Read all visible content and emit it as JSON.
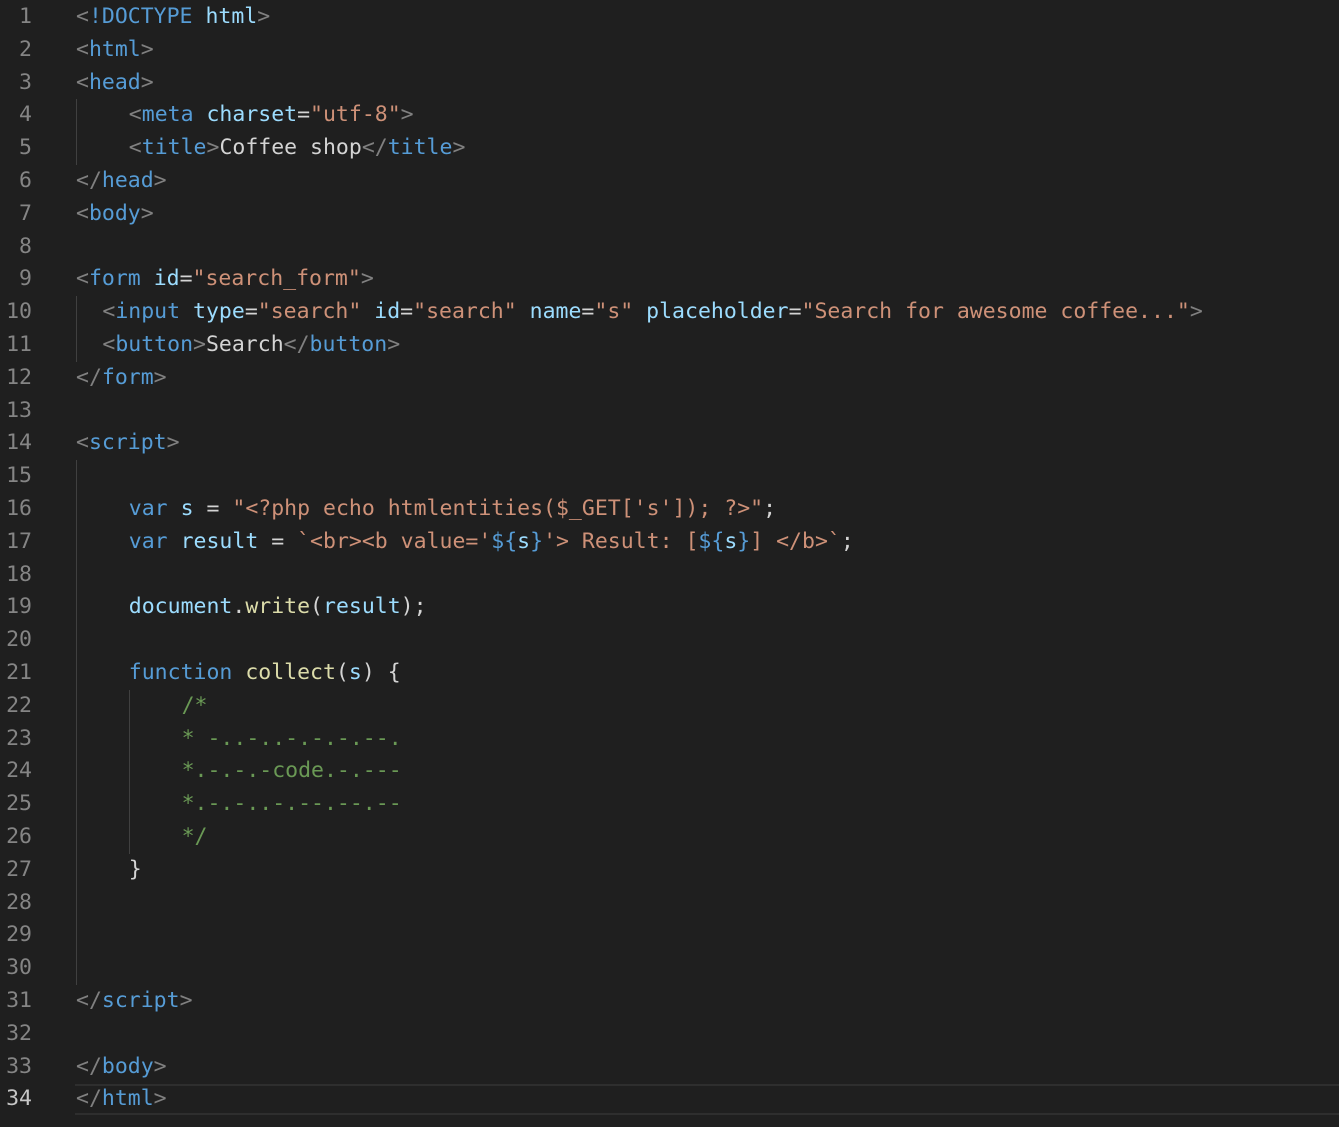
{
  "editor": {
    "current_line": 34,
    "lines": [
      {
        "n": "1",
        "indent": 0,
        "tokens": [
          [
            "punc",
            "<"
          ],
          [
            "tag",
            "!DOCTYPE"
          ],
          [
            "txt",
            " "
          ],
          [
            "attr",
            "html"
          ],
          [
            "punc",
            ">"
          ]
        ]
      },
      {
        "n": "2",
        "indent": 0,
        "tokens": [
          [
            "punc",
            "<"
          ],
          [
            "tag",
            "html"
          ],
          [
            "punc",
            ">"
          ]
        ]
      },
      {
        "n": "3",
        "indent": 0,
        "tokens": [
          [
            "punc",
            "<"
          ],
          [
            "tag",
            "head"
          ],
          [
            "punc",
            ">"
          ]
        ]
      },
      {
        "n": "4",
        "indent": 4,
        "tokens": [
          [
            "punc",
            "<"
          ],
          [
            "tag",
            "meta"
          ],
          [
            "txt",
            " "
          ],
          [
            "attr",
            "charset"
          ],
          [
            "txt",
            "="
          ],
          [
            "str",
            "\"utf-8\""
          ],
          [
            "punc",
            ">"
          ]
        ]
      },
      {
        "n": "5",
        "indent": 4,
        "tokens": [
          [
            "punc",
            "<"
          ],
          [
            "tag",
            "title"
          ],
          [
            "punc",
            ">"
          ],
          [
            "txt",
            "Coffee shop"
          ],
          [
            "punc",
            "</"
          ],
          [
            "tag",
            "title"
          ],
          [
            "punc",
            ">"
          ]
        ]
      },
      {
        "n": "6",
        "indent": 0,
        "tokens": [
          [
            "punc",
            "</"
          ],
          [
            "tag",
            "head"
          ],
          [
            "punc",
            ">"
          ]
        ]
      },
      {
        "n": "7",
        "indent": 0,
        "tokens": [
          [
            "punc",
            "<"
          ],
          [
            "tag",
            "body"
          ],
          [
            "punc",
            ">"
          ]
        ]
      },
      {
        "n": "8",
        "indent": 0,
        "tokens": []
      },
      {
        "n": "9",
        "indent": 0,
        "tokens": [
          [
            "punc",
            "<"
          ],
          [
            "tag",
            "form"
          ],
          [
            "txt",
            " "
          ],
          [
            "attr",
            "id"
          ],
          [
            "txt",
            "="
          ],
          [
            "str",
            "\"search_form\""
          ],
          [
            "punc",
            ">"
          ]
        ]
      },
      {
        "n": "10",
        "indent": 2,
        "tokens": [
          [
            "punc",
            "<"
          ],
          [
            "tag",
            "input"
          ],
          [
            "txt",
            " "
          ],
          [
            "attr",
            "type"
          ],
          [
            "txt",
            "="
          ],
          [
            "str",
            "\"search\""
          ],
          [
            "txt",
            " "
          ],
          [
            "attr",
            "id"
          ],
          [
            "txt",
            "="
          ],
          [
            "str",
            "\"search\""
          ],
          [
            "txt",
            " "
          ],
          [
            "attr",
            "name"
          ],
          [
            "txt",
            "="
          ],
          [
            "str",
            "\"s\""
          ],
          [
            "txt",
            " "
          ],
          [
            "attr",
            "placeholder"
          ],
          [
            "txt",
            "="
          ],
          [
            "str",
            "\"Search for awesome coffee...\""
          ],
          [
            "punc",
            ">"
          ]
        ]
      },
      {
        "n": "11",
        "indent": 2,
        "tokens": [
          [
            "punc",
            "<"
          ],
          [
            "tag",
            "button"
          ],
          [
            "punc",
            ">"
          ],
          [
            "txt",
            "Search"
          ],
          [
            "punc",
            "</"
          ],
          [
            "tag",
            "button"
          ],
          [
            "punc",
            ">"
          ]
        ]
      },
      {
        "n": "12",
        "indent": 0,
        "tokens": [
          [
            "punc",
            "</"
          ],
          [
            "tag",
            "form"
          ],
          [
            "punc",
            ">"
          ]
        ]
      },
      {
        "n": "13",
        "indent": 0,
        "tokens": []
      },
      {
        "n": "14",
        "indent": 0,
        "tokens": [
          [
            "punc",
            "<"
          ],
          [
            "tag",
            "script"
          ],
          [
            "punc",
            ">"
          ]
        ]
      },
      {
        "n": "15",
        "indent": 0,
        "tokens": []
      },
      {
        "n": "16",
        "indent": 4,
        "tokens": [
          [
            "kw",
            "var"
          ],
          [
            "txt",
            " "
          ],
          [
            "var",
            "s"
          ],
          [
            "txt",
            " = "
          ],
          [
            "str",
            "\"<?php echo htmlentities($_GET['s']); ?>\""
          ],
          [
            "txt",
            ";"
          ]
        ]
      },
      {
        "n": "17",
        "indent": 4,
        "tokens": [
          [
            "kw",
            "var"
          ],
          [
            "txt",
            " "
          ],
          [
            "var",
            "result"
          ],
          [
            "txt",
            " = "
          ],
          [
            "str",
            "`<br><b value='"
          ],
          [
            "kw",
            "${"
          ],
          [
            "var",
            "s"
          ],
          [
            "kw",
            "}"
          ],
          [
            "str",
            "'> Result: ["
          ],
          [
            "kw",
            "${"
          ],
          [
            "var",
            "s"
          ],
          [
            "kw",
            "}"
          ],
          [
            "str",
            "] </b>`"
          ],
          [
            "txt",
            ";"
          ]
        ]
      },
      {
        "n": "18",
        "indent": 0,
        "tokens": []
      },
      {
        "n": "19",
        "indent": 4,
        "tokens": [
          [
            "var",
            "document"
          ],
          [
            "txt",
            "."
          ],
          [
            "fn",
            "write"
          ],
          [
            "txt",
            "("
          ],
          [
            "var",
            "result"
          ],
          [
            "txt",
            ");"
          ]
        ]
      },
      {
        "n": "20",
        "indent": 0,
        "tokens": []
      },
      {
        "n": "21",
        "indent": 4,
        "tokens": [
          [
            "kw",
            "function"
          ],
          [
            "txt",
            " "
          ],
          [
            "fn",
            "collect"
          ],
          [
            "txt",
            "("
          ],
          [
            "var",
            "s"
          ],
          [
            "txt",
            ") {"
          ]
        ]
      },
      {
        "n": "22",
        "indent": 8,
        "tokens": [
          [
            "com",
            "/*"
          ]
        ]
      },
      {
        "n": "23",
        "indent": 8,
        "tokens": [
          [
            "com",
            "* -..-..-.-.-.--."
          ]
        ]
      },
      {
        "n": "24",
        "indent": 8,
        "tokens": [
          [
            "com",
            "*.-.-.-code.-.---"
          ]
        ]
      },
      {
        "n": "25",
        "indent": 8,
        "tokens": [
          [
            "com",
            "*.-.-..-.--.--.--"
          ]
        ]
      },
      {
        "n": "26",
        "indent": 8,
        "tokens": [
          [
            "com",
            "*/"
          ]
        ]
      },
      {
        "n": "27",
        "indent": 4,
        "tokens": [
          [
            "txt",
            "}"
          ]
        ]
      },
      {
        "n": "28",
        "indent": 0,
        "tokens": []
      },
      {
        "n": "29",
        "indent": 0,
        "tokens": []
      },
      {
        "n": "30",
        "indent": 0,
        "tokens": []
      },
      {
        "n": "31",
        "indent": 0,
        "tokens": [
          [
            "punc",
            "</"
          ],
          [
            "tag",
            "script"
          ],
          [
            "punc",
            ">"
          ]
        ]
      },
      {
        "n": "32",
        "indent": 0,
        "tokens": []
      },
      {
        "n": "33",
        "indent": 0,
        "tokens": [
          [
            "punc",
            "</"
          ],
          [
            "tag",
            "body"
          ],
          [
            "punc",
            ">"
          ]
        ]
      },
      {
        "n": "34",
        "indent": 0,
        "tokens": [
          [
            "punc",
            "</"
          ],
          [
            "tag",
            "html"
          ],
          [
            "punc",
            ">"
          ]
        ]
      }
    ]
  },
  "colors": {
    "background": "#1f1f1f",
    "line_number": "#858585",
    "tag": "#569cd6",
    "attribute": "#9cdcfe",
    "string": "#ce9178",
    "comment": "#6a9955",
    "function": "#dcdcaa"
  }
}
